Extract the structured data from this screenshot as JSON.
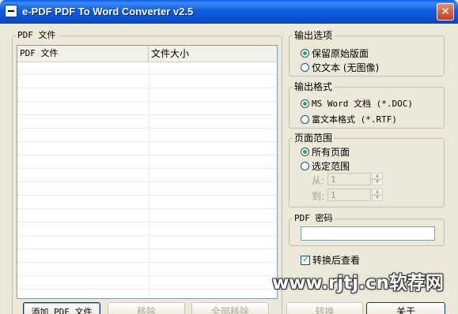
{
  "window": {
    "title": "e-PDF PDF To Word Converter v2.5",
    "close_glyph": "✕",
    "icons": {
      "system_menu": "system-menu-icon",
      "close": "close-icon"
    }
  },
  "file_group": {
    "label": "PDF 文件",
    "columns": [
      "PDF 文件",
      "文件大小"
    ]
  },
  "output_options": {
    "label": "输出选项",
    "options": [
      {
        "label": "保留原始版面",
        "selected": true
      },
      {
        "label": "仅文本 (无图像)",
        "selected": false
      }
    ]
  },
  "output_format": {
    "label": "输出格式",
    "options": [
      {
        "label": "MS Word 文档 (*.DOC)",
        "selected": true
      },
      {
        "label": "富文本格式 (*.RTF)",
        "selected": false
      }
    ]
  },
  "page_range": {
    "label": "页面范围",
    "options": [
      {
        "label": "所有页面",
        "selected": true
      },
      {
        "label": "选定范围",
        "selected": false
      }
    ],
    "from_label": "从:",
    "from_value": "1",
    "to_label": "到:",
    "to_value": "1"
  },
  "password": {
    "label": "PDF 密码",
    "value": ""
  },
  "view_after": {
    "label": "转换后查看",
    "checked": true
  },
  "buttons": {
    "add": "添加 PDF 文件",
    "remove": "移除",
    "remove_all": "全部移除",
    "convert": "转换",
    "close": "关于"
  },
  "watermark": "www.rjtj.cn软荐网",
  "colors": {
    "titlebar": "#0a5be6",
    "window_bg": "#ece9d8",
    "radio_selected": "#2fa83a"
  }
}
